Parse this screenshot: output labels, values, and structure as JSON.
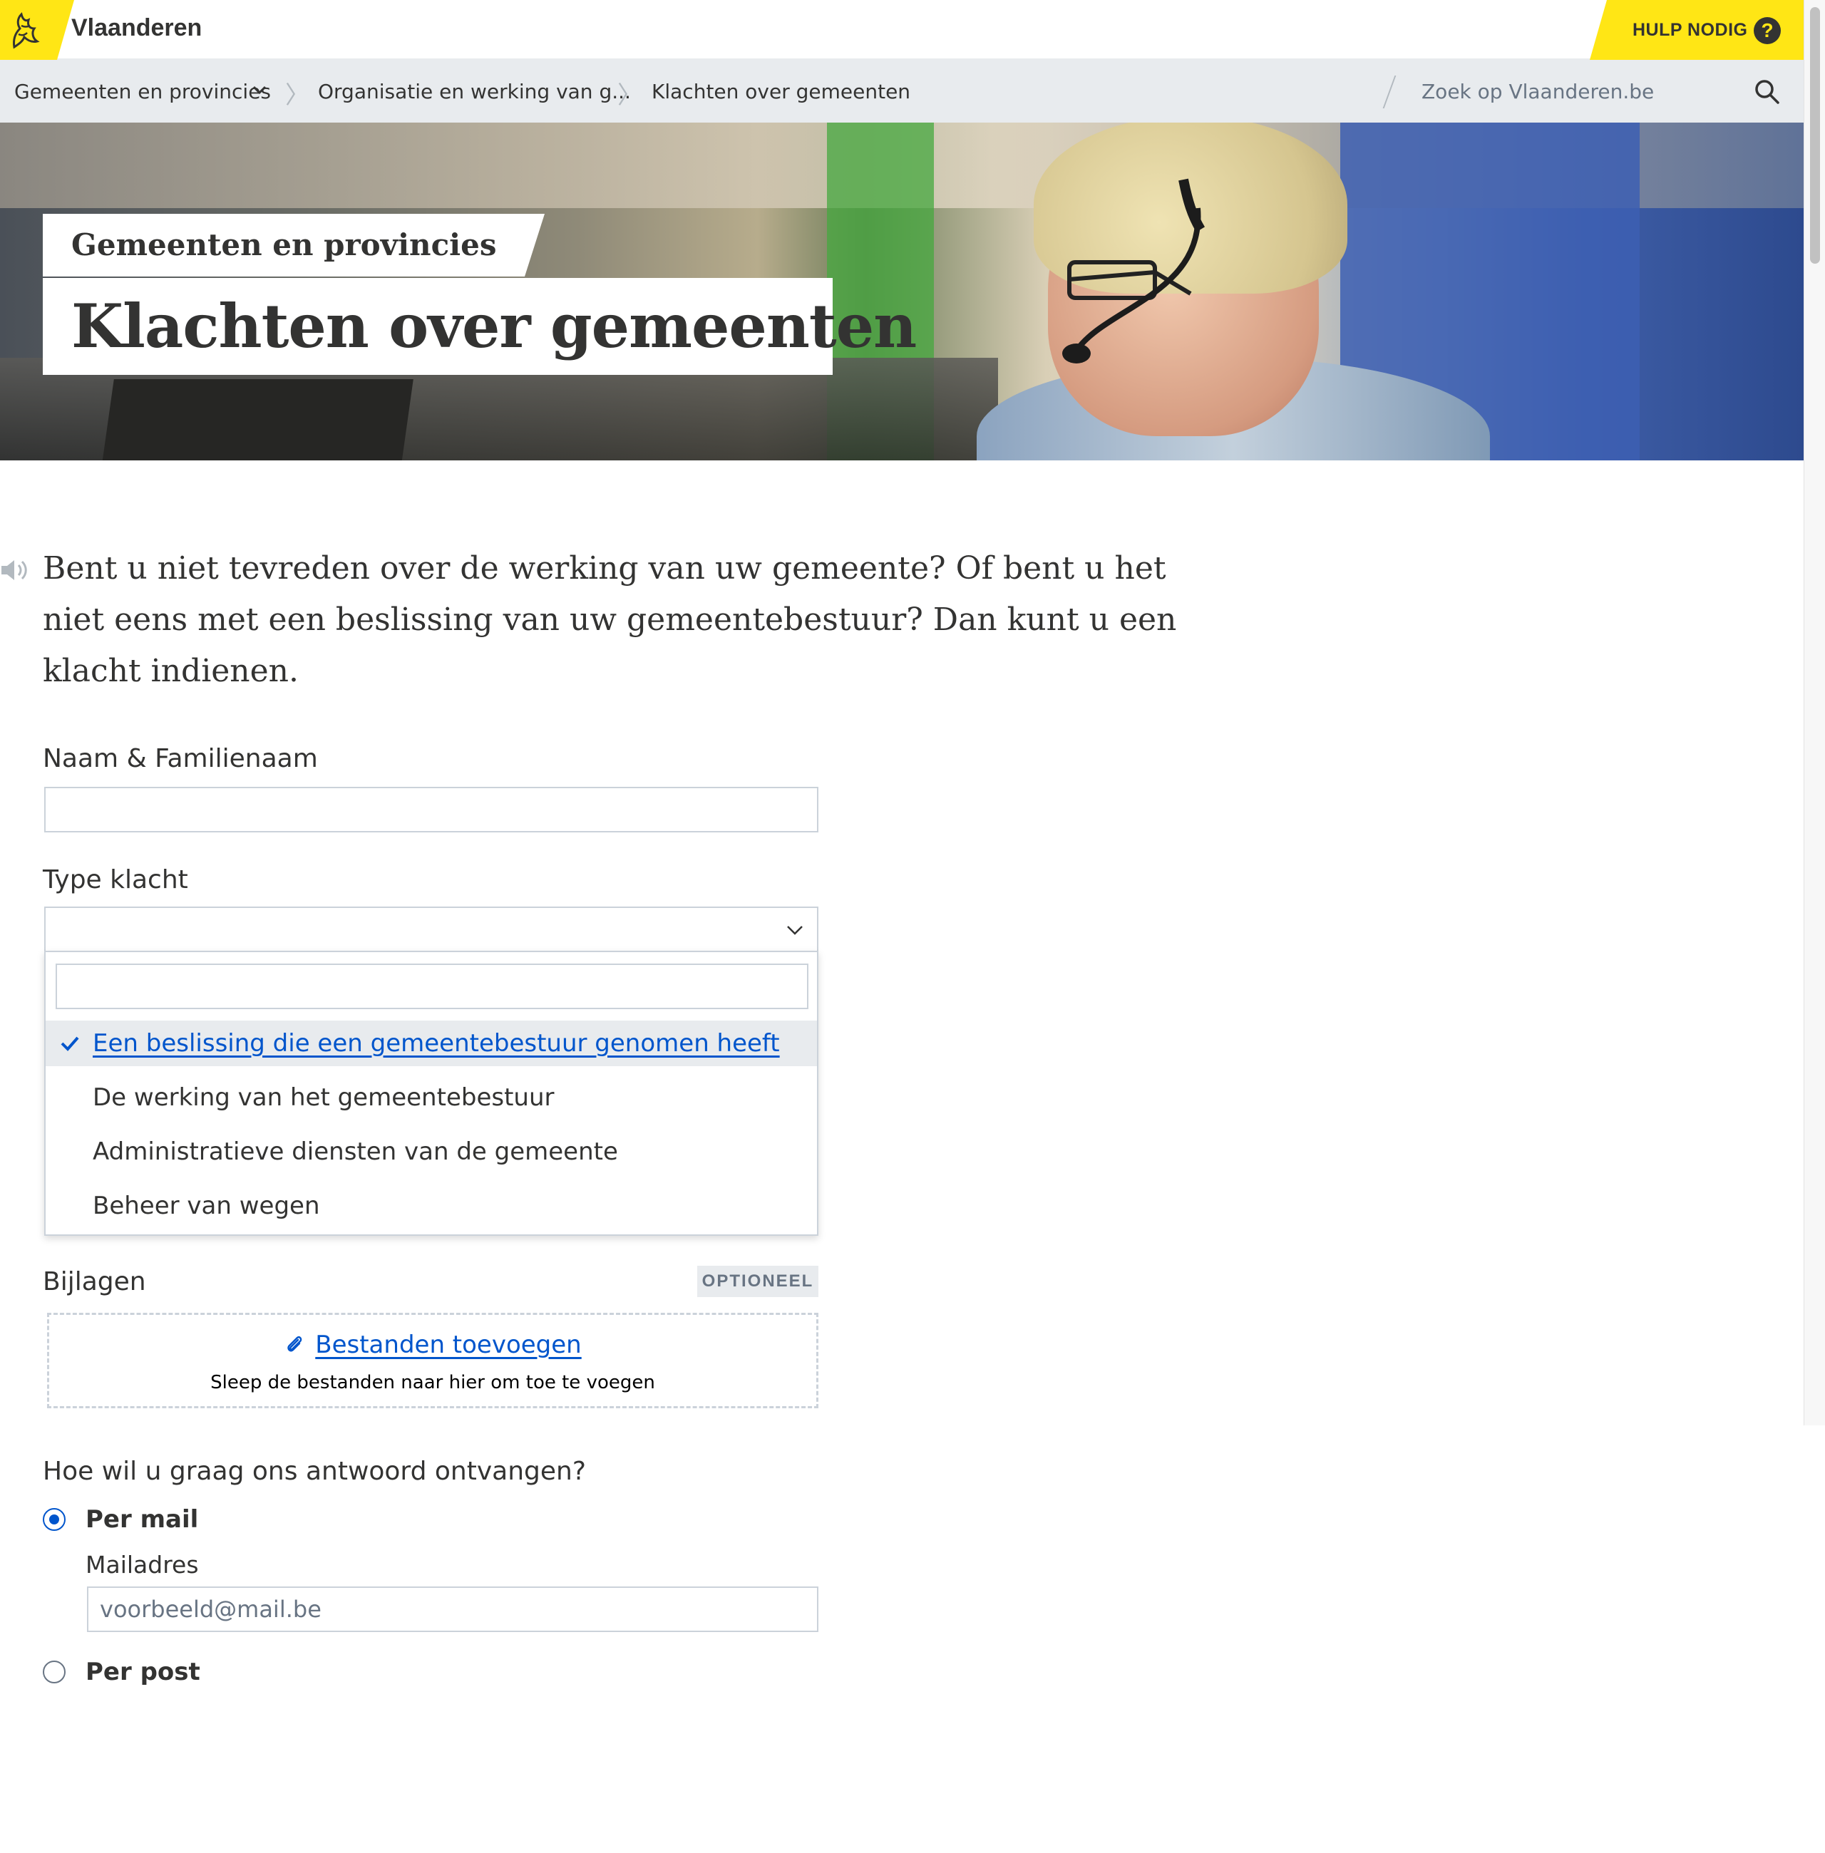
{
  "header": {
    "brand": "Vlaanderen",
    "help_label": "HULP NODIG",
    "help_icon_glyph": "?",
    "logo_icon": "flemish-lion-icon",
    "accent_color": "#ffe615"
  },
  "nav": {
    "breadcrumbs": [
      {
        "label": "Gemeenten en provincies"
      },
      {
        "label": "Organisatie en werking van g..."
      },
      {
        "label": "Klachten over gemeenten"
      }
    ],
    "separator": "〉",
    "search_placeholder": "Zoek op Vlaanderen.be"
  },
  "hero": {
    "subtitle": "Gemeenten en provincies",
    "title": "Klachten over gemeenten"
  },
  "intro": {
    "text": "Bent u niet tevreden over de werking van uw gemeente? Of bent u het niet eens met een beslissing van uw gemeentebestuur? Dan kunt u een klacht indienen."
  },
  "form": {
    "name_label": "Naam & Familienaam",
    "name_value": "",
    "type_label": "Type klacht",
    "type_value": "",
    "dropdown": {
      "search_value": "",
      "options": [
        {
          "label": "Een beslissing die een gemeentebestuur genomen heeft",
          "selected": true
        },
        {
          "label": "De werking van het gemeentebestuur",
          "selected": false
        },
        {
          "label": "Administratieve diensten van de gemeente",
          "selected": false
        },
        {
          "label": "Beheer van wegen",
          "selected": false
        }
      ]
    },
    "attachments_label": "Bijlagen",
    "optional_badge": "OPTIONEEL",
    "upload_link": "Bestanden toevoegen",
    "upload_hint": "Sleep de bestanden naar hier om toe te voegen",
    "reply_question": "Hoe wil u graag ons antwoord ontvangen?",
    "reply_options": [
      {
        "label": "Per mail",
        "checked": true
      },
      {
        "label": "Per post",
        "checked": false
      }
    ],
    "email_label": "Mailadres",
    "email_placeholder": "voorbeeld@mail.be"
  },
  "colors": {
    "link": "#0055cc",
    "text": "#333332",
    "muted": "#687483",
    "border": "#cbd2da",
    "nav_bg": "#e8ebee"
  }
}
